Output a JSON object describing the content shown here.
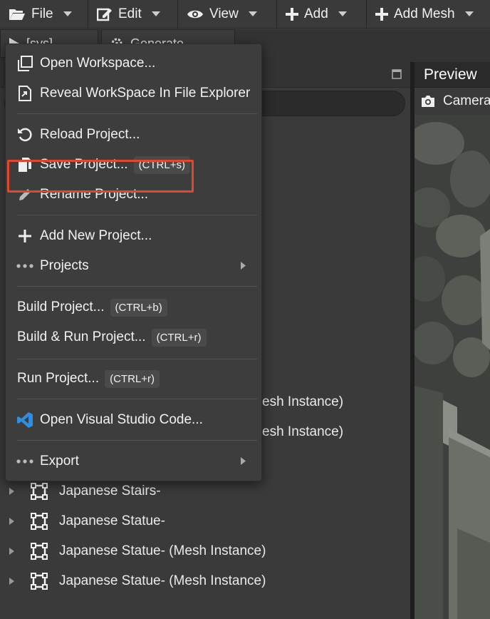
{
  "menubar": {
    "items": [
      {
        "label": "File",
        "icon": "folder-open-icon"
      },
      {
        "label": "Edit",
        "icon": "edit-square-icon"
      },
      {
        "label": "View",
        "icon": "eye-icon"
      },
      {
        "label": "Add",
        "icon": "plus-icon"
      },
      {
        "label": "Add Mesh",
        "icon": "plus-icon"
      }
    ]
  },
  "toolbar2": {
    "play_label": "[sys]",
    "generate_label": "Generate"
  },
  "preview": {
    "tab_label": "Preview",
    "camera_label": "Camera"
  },
  "scene_tree": {
    "partial_rows": [
      "esh Instance)",
      "esh Instance)"
    ],
    "rows": [
      {
        "label": "Japanese Stairs-"
      },
      {
        "label": "Japanese Statue-"
      },
      {
        "label": "Japanese Statue- (Mesh Instance)"
      },
      {
        "label": "Japanese Statue- (Mesh Instance)"
      }
    ]
  },
  "file_menu": {
    "open_workspace": "Open Workspace...",
    "reveal_workspace": "Reveal WorkSpace In File Explorer",
    "reload_project": "Reload Project...",
    "save_project": "Save Project...",
    "save_shortcut": "(CTRL+s)",
    "rename_project": "Rename Project...",
    "add_new_project": "Add New Project...",
    "projects": "Projects",
    "build_project": "Build Project...",
    "build_shortcut": "(CTRL+b)",
    "build_run_project": "Build & Run Project...",
    "build_run_shortcut": "(CTRL+r)",
    "run_project": "Run Project...",
    "run_shortcut": "(CTRL+r)",
    "open_vscode": "Open Visual Studio Code...",
    "export": "Export"
  },
  "colors": {
    "highlight": "#e0472c",
    "vscode_blue": "#2f8fdd"
  }
}
